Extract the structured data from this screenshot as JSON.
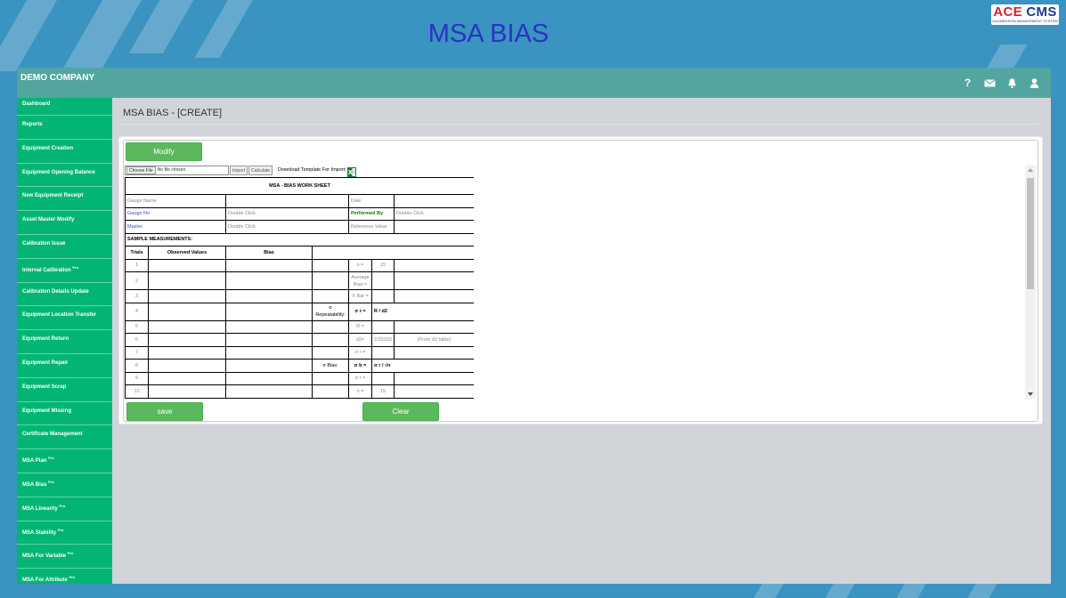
{
  "page": {
    "title": "MSA BIAS"
  },
  "logo": {
    "main": "ACE",
    "accent": "CMS",
    "sub": "CALIBRATION MANAGEMENT SYSTEM"
  },
  "topbar": {
    "company": "DEMO COMPANY",
    "help": "?"
  },
  "sidebar": {
    "items": [
      {
        "label": "Dashboard",
        "pro": ""
      },
      {
        "label": "Reports",
        "pro": ""
      },
      {
        "label": "Equipment Creation",
        "pro": ""
      },
      {
        "label": "Equipment Opening Balance",
        "pro": ""
      },
      {
        "label": "New Equipment Receipt",
        "pro": ""
      },
      {
        "label": "Asset Master Modify",
        "pro": ""
      },
      {
        "label": "Calibration Issue",
        "pro": ""
      },
      {
        "label": "Internal Calibration",
        "pro": "Pro"
      },
      {
        "label": "Calibration Details Update",
        "pro": ""
      },
      {
        "label": "Equipment Location Transfer",
        "pro": ""
      },
      {
        "label": "Equipment Return",
        "pro": ""
      },
      {
        "label": "Equipment Repair",
        "pro": ""
      },
      {
        "label": "Equipment Scrap",
        "pro": ""
      },
      {
        "label": "Equipment Missing",
        "pro": ""
      },
      {
        "label": "Certificate Management",
        "pro": ""
      },
      {
        "label": "MSA Plan",
        "pro": "Pro"
      },
      {
        "label": "MSA Bias",
        "pro": "Pro"
      },
      {
        "label": "MSA Linearity",
        "pro": "Pro"
      },
      {
        "label": "MSA Stability",
        "pro": "Pro"
      },
      {
        "label": "MSA For Variable",
        "pro": "Pro"
      },
      {
        "label": "MSA For Attribute",
        "pro": "Pro"
      }
    ]
  },
  "breadcrumb": "MSA BIAS - [CREATE]",
  "toolbar": {
    "modify": "Modify",
    "choose_file": "Choose File",
    "no_file": "No file chosen",
    "import": "Import",
    "calculate": "Calculate",
    "download_label": "Download Template For Import:"
  },
  "worksheet": {
    "title": "MSA - BIAS WORK SHEET",
    "gauge_name": "Gauge Name",
    "date": "Date",
    "gauge_no": "Gauge No",
    "double_click": "Double Click",
    "performed_by": "Performed By",
    "master": "Master",
    "reference_value": "Reference Value",
    "sample_measurements": "SAMPLE MEASUREMENTS:",
    "col_trials": "Trials",
    "col_observed": "Observed Values",
    "col_bias": "Bias",
    "trials": [
      "1",
      "2",
      "3",
      "4",
      "5",
      "6",
      "7",
      "8",
      "9",
      "10"
    ],
    "n_label": "n =",
    "n_value": "15",
    "average_bias": "Average Bias =",
    "xbar": "X Bar =",
    "sigma": "σ",
    "repeatability": "Repeatability:",
    "sigma_r": "σ r =",
    "r_d2": "R / d2",
    "r_eq": "R =",
    "d2_label": "d2=",
    "d2_value": "3.55333",
    "d2_note": "(From d2 table)",
    "sigma_r_eq": "σ r =",
    "sigma_bias": "σ Bias:",
    "sigma_b": "σ b =",
    "sigma_r_root_n": "σ r / √n",
    "n_label_2": "n =",
    "n_value_2": "15"
  },
  "actions": {
    "save": "save",
    "clear": "Clear"
  },
  "colors": {
    "background": "#3a93c0",
    "topbar": "#52a69f",
    "sidebar": "#03b573",
    "button": "#5cb85c",
    "title": "#2a34c4"
  }
}
